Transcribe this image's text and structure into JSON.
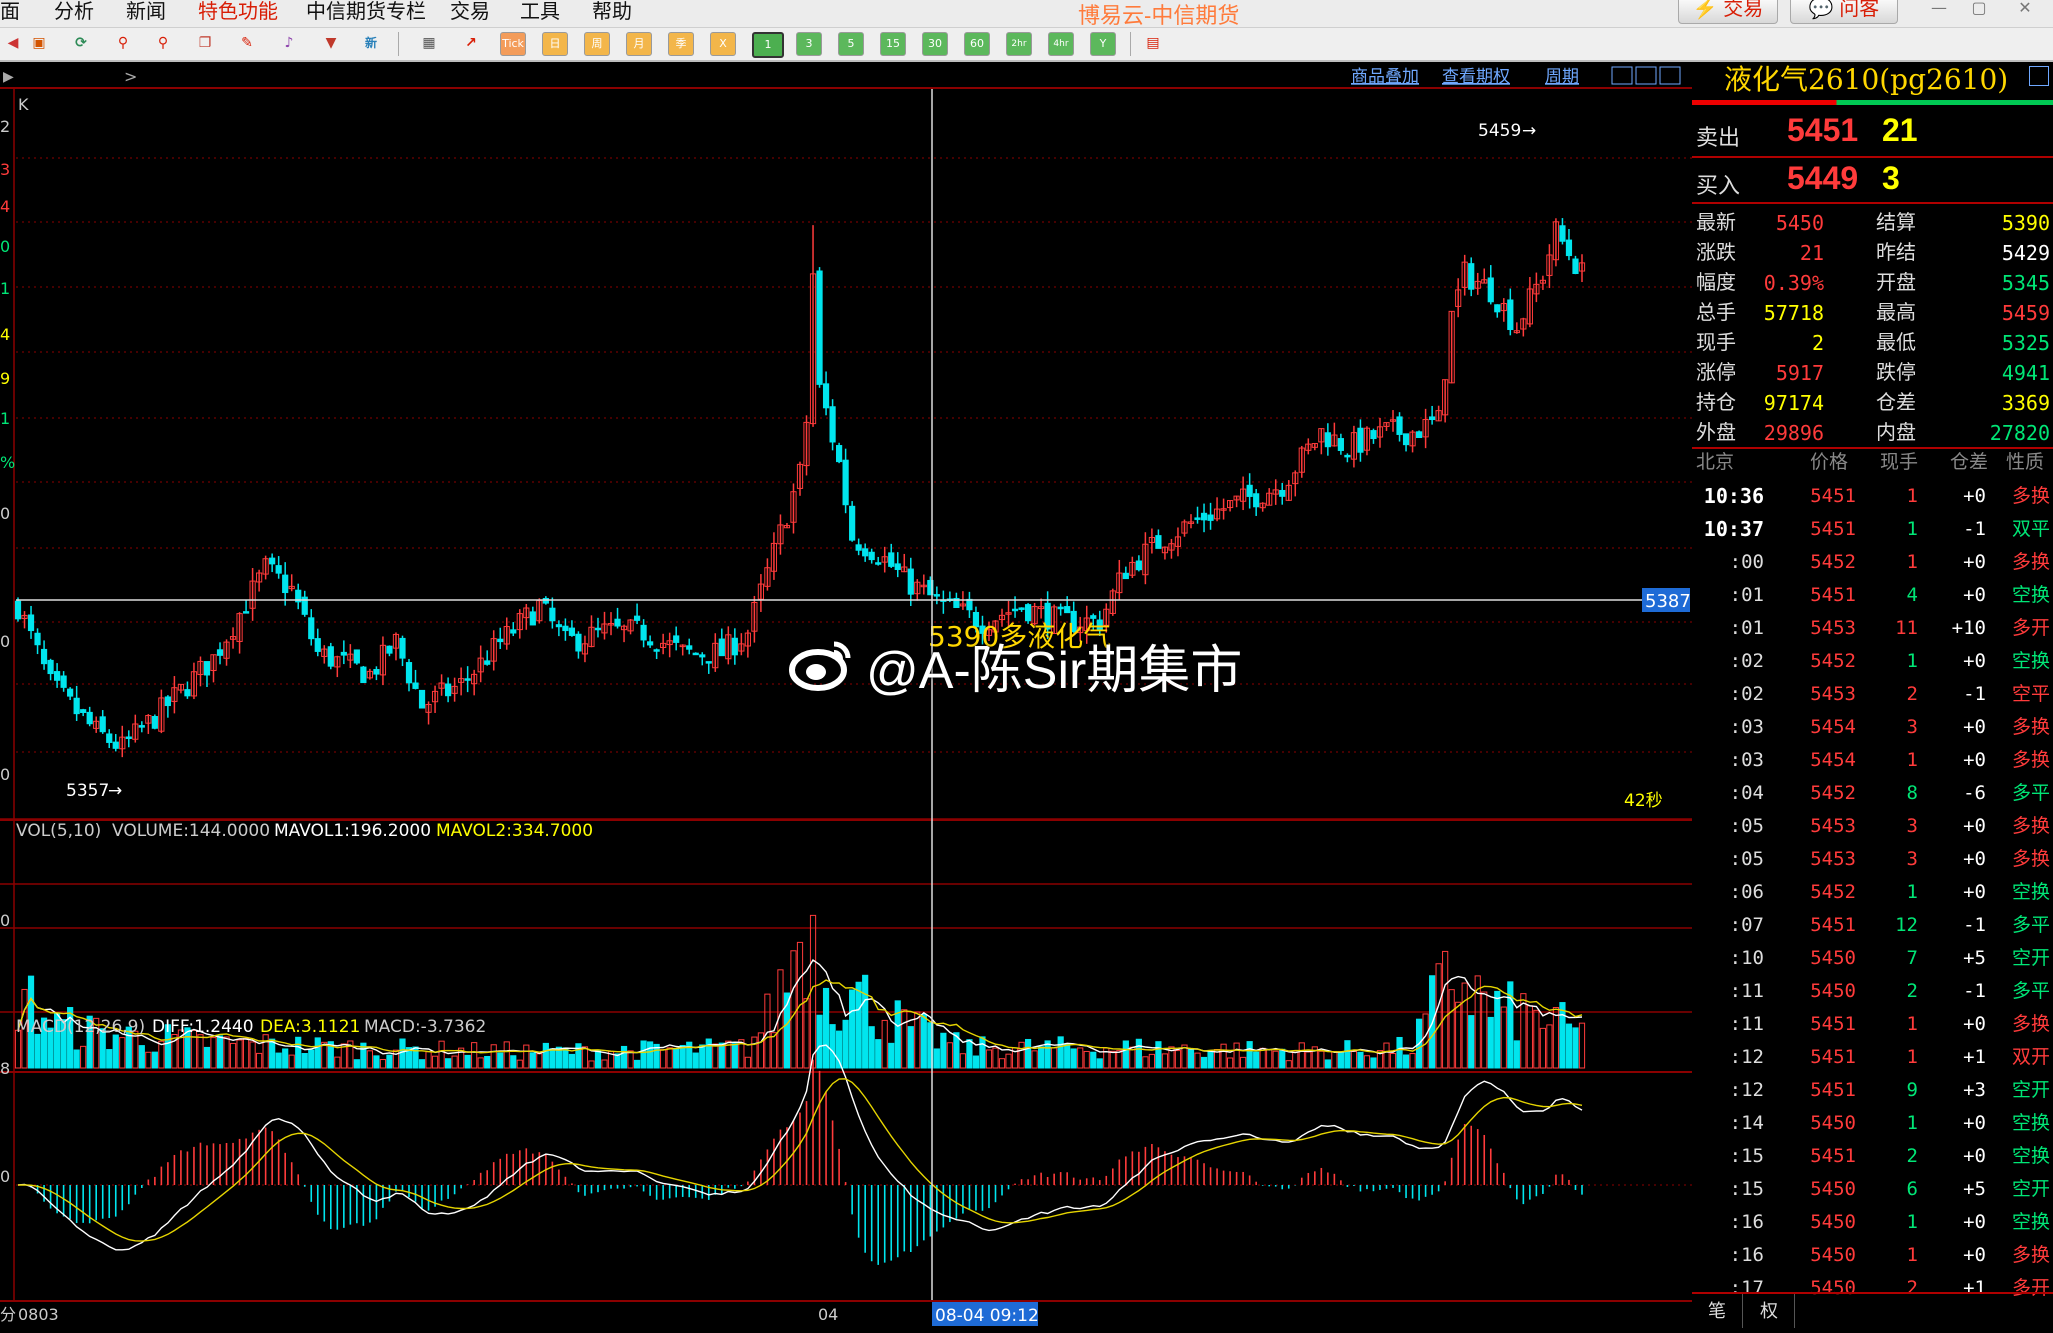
{
  "menu": [
    "面",
    "分析",
    "新闻",
    "特色功能",
    "中信期货专栏",
    "交易",
    "工具",
    "帮助"
  ],
  "app_title": "博易云-中信期货",
  "top_buttons": {
    "trade": "交易",
    "ask": "问客"
  },
  "toolbar": {
    "periods": [
      "1",
      "3",
      "5",
      "15",
      "30",
      "60",
      "2hr",
      "4hr",
      "Y"
    ],
    "cal": [
      "日",
      "周",
      "月",
      "季",
      "X"
    ],
    "tick": "Tick"
  },
  "chart_header": {
    "nav": [
      "商品叠加",
      "查看期权",
      "周期"
    ],
    "k_label": "K"
  },
  "crosshair": {
    "price_label": "5387",
    "time_label": "08-04 09:12"
  },
  "annotations": {
    "high": "5459",
    "low": "5357",
    "countdown": "42秒",
    "overlay": "5390多液化气"
  },
  "volume_header": {
    "title": "VOL(5,10)",
    "volume": "VOLUME:144.0000",
    "mavol1": "MAVOL1:196.2000",
    "mavol2": "MAVOL2:334.7000"
  },
  "macd_header": {
    "title": "MACD(12,26,9)",
    "diff": "DIFF:1.2440",
    "dea": "DEA:3.1121",
    "macd": "MACD:-3.7362"
  },
  "x_axis": {
    "left": "0803",
    "mid": "04",
    "corner": "分"
  },
  "left_axis_fragments": [
    "2",
    "3",
    "4",
    "0",
    "1",
    "4",
    "9",
    "1",
    "%",
    "0",
    "0",
    "0"
  ],
  "vol_axis": [
    "0"
  ],
  "macd_axis": [
    "8",
    "0"
  ],
  "colors": {
    "up": "#ff3b3b",
    "down": "#00e5ee",
    "dea": "#e5d400",
    "diff": "#ffffff",
    "grid": "#8b0000"
  },
  "panel": {
    "title": "液化气2610(pg2610)",
    "ask": {
      "label": "卖出",
      "price": "5451",
      "vol": "21"
    },
    "bid": {
      "label": "买入",
      "price": "5449",
      "vol": "3"
    },
    "quotes": [
      {
        "l": "最新",
        "v": "5450",
        "vc": "#ff3b3b",
        "l2": "结算",
        "v2": "5390",
        "v2c": "#ffff00"
      },
      {
        "l": "涨跌",
        "v": "21",
        "vc": "#ff3b3b",
        "l2": "昨结",
        "v2": "5429",
        "v2c": "#ffffff"
      },
      {
        "l": "幅度",
        "v": "0.39%",
        "vc": "#ff3b3b",
        "l2": "开盘",
        "v2": "5345",
        "v2c": "#00e676"
      },
      {
        "l": "总手",
        "v": "57718",
        "vc": "#ffff00",
        "l2": "最高",
        "v2": "5459",
        "v2c": "#ff3b3b"
      },
      {
        "l": "现手",
        "v": "2",
        "vc": "#ffff00",
        "l2": "最低",
        "v2": "5325",
        "v2c": "#00e676"
      },
      {
        "l": "涨停",
        "v": "5917",
        "vc": "#ff3b3b",
        "l2": "跌停",
        "v2": "4941",
        "v2c": "#00e676"
      },
      {
        "l": "持仓",
        "v": "97174",
        "vc": "#ffff00",
        "l2": "仓差",
        "v2": "3369",
        "v2c": "#ffff00"
      },
      {
        "l": "外盘",
        "v": "29896",
        "vc": "#ff3b3b",
        "l2": "内盘",
        "v2": "27820",
        "v2c": "#00e676"
      }
    ],
    "tick_header": [
      "北京",
      "价格",
      "现手",
      "仓差",
      "性质"
    ],
    "ticks": [
      {
        "t": "10:36",
        "p": "5451",
        "v": "1",
        "vc": "#ff3b3b",
        "oi": "+0",
        "k": "多换",
        "kc": "#ff3b3b",
        "bold": true
      },
      {
        "t": "10:37",
        "p": "5451",
        "v": "1",
        "vc": "#00e676",
        "oi": "-1",
        "k": "双平",
        "kc": "#00e676",
        "bold": true
      },
      {
        "t": ":00",
        "p": "5452",
        "v": "1",
        "vc": "#ff3b3b",
        "oi": "+0",
        "k": "多换",
        "kc": "#ff3b3b"
      },
      {
        "t": ":01",
        "p": "5451",
        "v": "4",
        "vc": "#00e676",
        "oi": "+0",
        "k": "空换",
        "kc": "#00e676"
      },
      {
        "t": ":01",
        "p": "5453",
        "v": "11",
        "vc": "#ff3b3b",
        "oi": "+10",
        "k": "多开",
        "kc": "#ff3b3b"
      },
      {
        "t": ":02",
        "p": "5452",
        "v": "1",
        "vc": "#00e676",
        "oi": "+0",
        "k": "空换",
        "kc": "#00e676"
      },
      {
        "t": ":02",
        "p": "5453",
        "v": "2",
        "vc": "#ff3b3b",
        "oi": "-1",
        "k": "空平",
        "kc": "#ff3b3b"
      },
      {
        "t": ":03",
        "p": "5454",
        "v": "3",
        "vc": "#ff3b3b",
        "oi": "+0",
        "k": "多换",
        "kc": "#ff3b3b"
      },
      {
        "t": ":03",
        "p": "5454",
        "v": "1",
        "vc": "#ff3b3b",
        "oi": "+0",
        "k": "多换",
        "kc": "#ff3b3b"
      },
      {
        "t": ":04",
        "p": "5452",
        "v": "8",
        "vc": "#00e676",
        "oi": "-6",
        "k": "多平",
        "kc": "#00e676"
      },
      {
        "t": ":05",
        "p": "5453",
        "v": "3",
        "vc": "#ff3b3b",
        "oi": "+0",
        "k": "多换",
        "kc": "#ff3b3b"
      },
      {
        "t": ":05",
        "p": "5453",
        "v": "3",
        "vc": "#ff3b3b",
        "oi": "+0",
        "k": "多换",
        "kc": "#ff3b3b"
      },
      {
        "t": ":06",
        "p": "5452",
        "v": "1",
        "vc": "#00e676",
        "oi": "+0",
        "k": "空换",
        "kc": "#00e676"
      },
      {
        "t": ":07",
        "p": "5451",
        "v": "12",
        "vc": "#00e676",
        "oi": "-1",
        "k": "多平",
        "kc": "#00e676"
      },
      {
        "t": ":10",
        "p": "5450",
        "v": "7",
        "vc": "#00e676",
        "oi": "+5",
        "k": "空开",
        "kc": "#00e676"
      },
      {
        "t": ":11",
        "p": "5450",
        "v": "2",
        "vc": "#00e676",
        "oi": "-1",
        "k": "多平",
        "kc": "#00e676"
      },
      {
        "t": ":11",
        "p": "5451",
        "v": "1",
        "vc": "#ff3b3b",
        "oi": "+0",
        "k": "多换",
        "kc": "#ff3b3b"
      },
      {
        "t": ":12",
        "p": "5451",
        "v": "1",
        "vc": "#ff3b3b",
        "oi": "+1",
        "k": "双开",
        "kc": "#ff3b3b"
      },
      {
        "t": ":12",
        "p": "5451",
        "v": "9",
        "vc": "#00e676",
        "oi": "+3",
        "k": "空开",
        "kc": "#00e676"
      },
      {
        "t": ":14",
        "p": "5450",
        "v": "1",
        "vc": "#00e676",
        "oi": "+0",
        "k": "空换",
        "kc": "#00e676"
      },
      {
        "t": ":15",
        "p": "5451",
        "v": "2",
        "vc": "#00e676",
        "oi": "+0",
        "k": "空换",
        "kc": "#00e676"
      },
      {
        "t": ":15",
        "p": "5450",
        "v": "6",
        "vc": "#00e676",
        "oi": "+5",
        "k": "空开",
        "kc": "#00e676"
      },
      {
        "t": ":16",
        "p": "5450",
        "v": "1",
        "vc": "#00e676",
        "oi": "+0",
        "k": "空换",
        "kc": "#00e676"
      },
      {
        "t": ":16",
        "p": "5450",
        "v": "1",
        "vc": "#ff3b3b",
        "oi": "+0",
        "k": "多换",
        "kc": "#ff3b3b"
      },
      {
        "t": ":17",
        "p": "5450",
        "v": "2",
        "vc": "#ff3b3b",
        "oi": "+1",
        "k": "多开",
        "kc": "#ff3b3b"
      }
    ],
    "tabs": [
      "笔",
      "权"
    ]
  },
  "watermark": "@A-陈Sir期集市",
  "chart_data": {
    "type": "candlestick",
    "ylim": [
      5350,
      5470
    ],
    "anchors_close": [
      [
        0,
        5385
      ],
      [
        5,
        5370
      ],
      [
        12,
        5361
      ],
      [
        16,
        5358
      ],
      [
        22,
        5365
      ],
      [
        30,
        5375
      ],
      [
        38,
        5392
      ],
      [
        42,
        5388
      ],
      [
        46,
        5376
      ],
      [
        54,
        5372
      ],
      [
        58,
        5378
      ],
      [
        62,
        5366
      ],
      [
        68,
        5370
      ],
      [
        74,
        5378
      ],
      [
        80,
        5385
      ],
      [
        84,
        5378
      ],
      [
        90,
        5380
      ],
      [
        96,
        5380
      ],
      [
        102,
        5376
      ],
      [
        108,
        5376
      ],
      [
        112,
        5380
      ],
      [
        116,
        5395
      ],
      [
        120,
        5410
      ],
      [
        122,
        5430
      ],
      [
        124,
        5422
      ],
      [
        126,
        5412
      ],
      [
        128,
        5398
      ],
      [
        132,
        5395
      ],
      [
        136,
        5390
      ],
      [
        142,
        5385
      ],
      [
        148,
        5382
      ],
      [
        154,
        5385
      ],
      [
        160,
        5382
      ],
      [
        166,
        5382
      ],
      [
        170,
        5392
      ],
      [
        176,
        5398
      ],
      [
        182,
        5402
      ],
      [
        188,
        5405
      ],
      [
        194,
        5408
      ],
      [
        200,
        5418
      ],
      [
        204,
        5415
      ],
      [
        210,
        5418
      ],
      [
        214,
        5418
      ],
      [
        218,
        5420
      ],
      [
        220,
        5440
      ],
      [
        222,
        5448
      ],
      [
        226,
        5445
      ],
      [
        230,
        5438
      ],
      [
        234,
        5448
      ],
      [
        236,
        5456
      ],
      [
        240,
        5448
      ]
    ],
    "volume_anchors": [
      [
        0,
        0.45
      ],
      [
        6,
        0.25
      ],
      [
        14,
        0.2
      ],
      [
        30,
        0.15
      ],
      [
        50,
        0.12
      ],
      [
        70,
        0.1
      ],
      [
        90,
        0.1
      ],
      [
        112,
        0.12
      ],
      [
        116,
        0.35
      ],
      [
        121,
        0.9
      ],
      [
        124,
        0.5
      ],
      [
        130,
        0.4
      ],
      [
        136,
        0.25
      ],
      [
        145,
        0.12
      ],
      [
        170,
        0.12
      ],
      [
        200,
        0.1
      ],
      [
        214,
        0.12
      ],
      [
        218,
        0.45
      ],
      [
        221,
        0.55
      ],
      [
        226,
        0.35
      ],
      [
        234,
        0.3
      ],
      [
        240,
        0.2
      ]
    ],
    "macd_note": "DIFF:1.2440 DEA:3.1121 MACD:-3.7362"
  }
}
